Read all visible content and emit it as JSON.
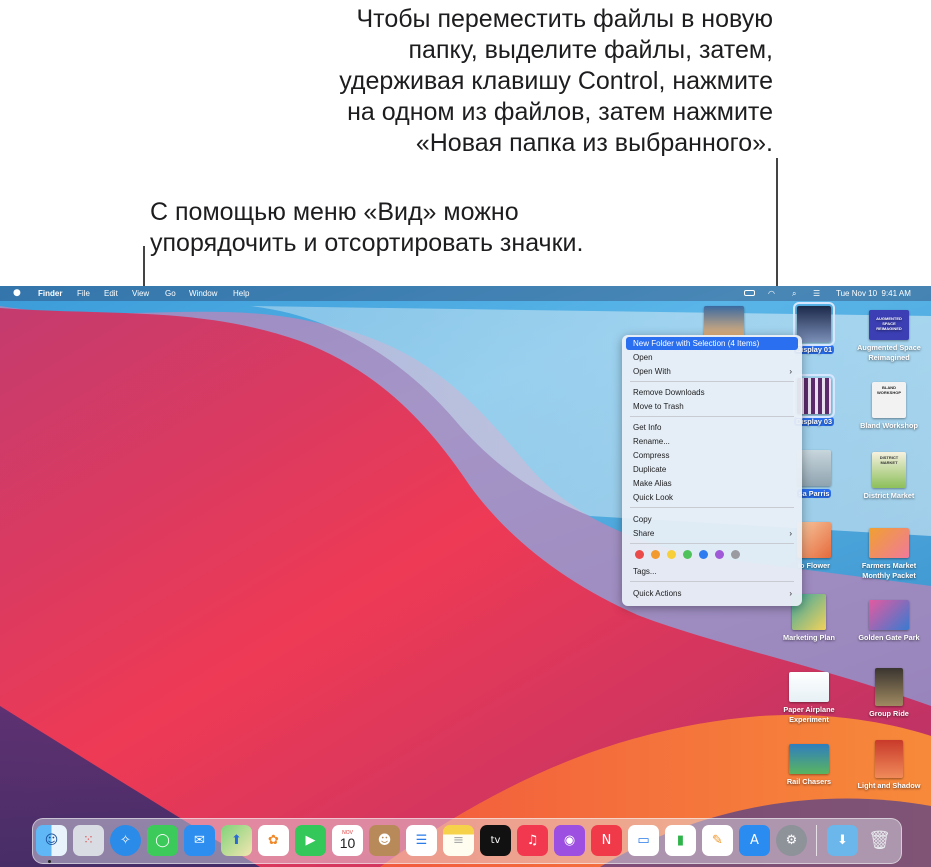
{
  "callouts": {
    "top": [
      "Чтобы переместить файлы в новую",
      "папку, выделите файлы, затем,",
      "удерживая клавишу Control, нажмите",
      "на одном из файлов, затем нажмите",
      "«Новая папка из выбранного»."
    ],
    "left": [
      "С помощью меню «Вид» можно",
      "упорядочить и отсортировать значки."
    ]
  },
  "menubar": {
    "app_name": "Finder",
    "menus": [
      "File",
      "Edit",
      "View",
      "Go",
      "Window",
      "Help"
    ],
    "datetime": "Tue Nov 10  9:41 AM"
  },
  "context_menu": {
    "items": [
      "New Folder with Selection (4 Items)",
      "Open",
      "Open With",
      "Remove Downloads",
      "Move to Trash",
      "Get Info",
      "Rename...",
      "Compress",
      "Duplicate",
      "Make Alias",
      "Quick Look",
      "Copy",
      "Share",
      "Tags...",
      "Quick Actions"
    ],
    "submenu_arrow": "›",
    "tag_colors": [
      "#ea4a4a",
      "#f29a2e",
      "#f6cf3a",
      "#4fc35b",
      "#2f7bf0",
      "#a05ad8",
      "#9a9aa0"
    ]
  },
  "desktop_icons": {
    "col1": [
      "Display 01",
      "Display 03",
      "sa Parris",
      "io Flower",
      "Marketing Plan",
      "Paper Airplane Experiment",
      "Rail Chasers"
    ],
    "col2": [
      "Augmented Space Reimagined",
      "Bland Workshop",
      "District Market",
      "Farmers Market Monthly Packet",
      "Golden Gate Park",
      "Group Ride",
      "Light and Shadow"
    ],
    "thumb_text": {
      "augmented": "AUGMENTED SPACE REIMAGINED",
      "bland": "BLAND WORKSHOP",
      "district": "DISTRICT MARKET"
    }
  },
  "dock": {
    "calendar_month": "NOV",
    "calendar_day": "10",
    "tv_label": "tv",
    "apps": [
      "finder",
      "launchpad",
      "safari",
      "messages",
      "mail",
      "maps",
      "photos",
      "facetime",
      "calendar",
      "contacts",
      "reminders",
      "notes",
      "tv",
      "music",
      "podcasts",
      "news",
      "keynote",
      "numbers",
      "pages",
      "app-store",
      "system-preferences",
      "downloads",
      "trash"
    ]
  }
}
